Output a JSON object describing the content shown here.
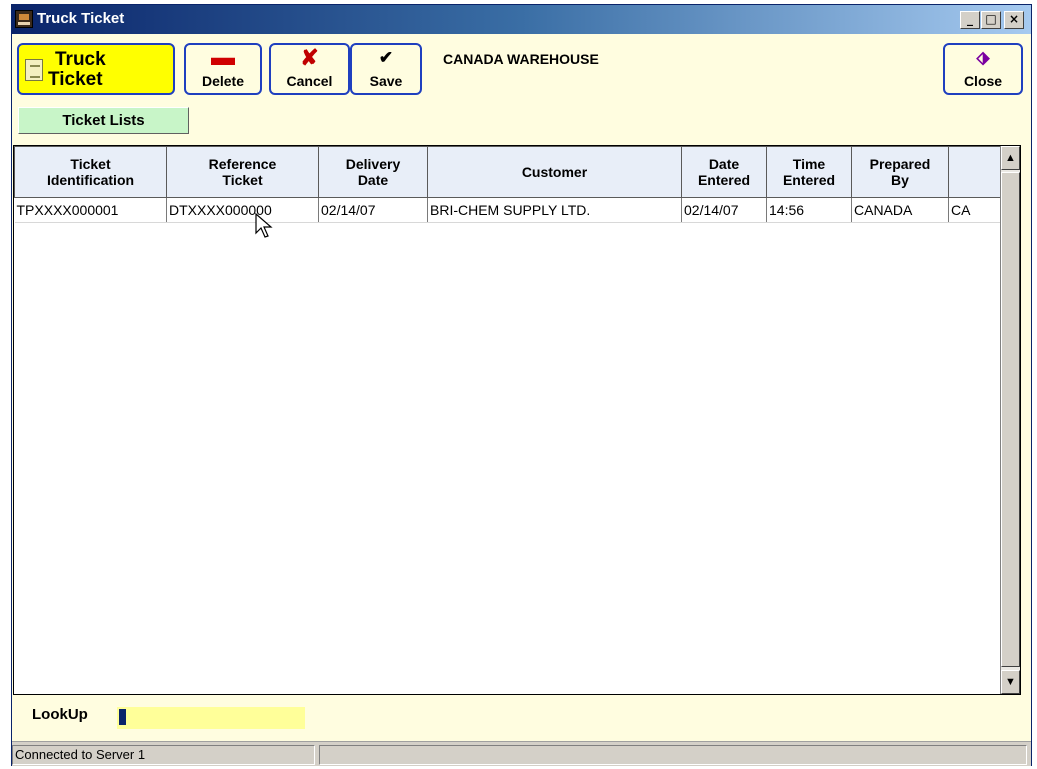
{
  "window": {
    "title": "Truck Ticket",
    "controls": {
      "minimize": "_",
      "maximize": "□",
      "close": "×"
    }
  },
  "toolbar": {
    "truck_ticket_line1": "Truck",
    "truck_ticket_line2": "Ticket",
    "delete_label": "Delete",
    "cancel_label": "Cancel",
    "save_label": "Save",
    "close_label": "Close",
    "warehouse": "CANADA WAREHOUSE"
  },
  "ticket_lists_label": "Ticket Lists",
  "table": {
    "headers": [
      [
        "Ticket",
        "Identification"
      ],
      [
        "Reference",
        "Ticket"
      ],
      [
        "Delivery",
        "Date"
      ],
      [
        "Customer",
        ""
      ],
      [
        "Date",
        "Entered"
      ],
      [
        "Time",
        "Entered"
      ],
      [
        "Prepared",
        "By"
      ],
      [
        "",
        ""
      ]
    ],
    "rows": [
      [
        "TPXXXX000001",
        "DTXXXX000000",
        "02/14/07",
        "BRI-CHEM SUPPLY LTD.",
        "02/14/07",
        "14:56",
        "CANADA",
        "CA"
      ]
    ]
  },
  "lookup": {
    "label": "LookUp",
    "value": ""
  },
  "status": {
    "message": "Connected to Server 1",
    "secondary": ""
  },
  "colors": {
    "window_bg": "#fffde0",
    "truck_button": "#ffff00",
    "ticket_lists_button": "#c8f5c8",
    "lookup_input": "#ffff99",
    "titlebar_start": "#0a246a"
  }
}
